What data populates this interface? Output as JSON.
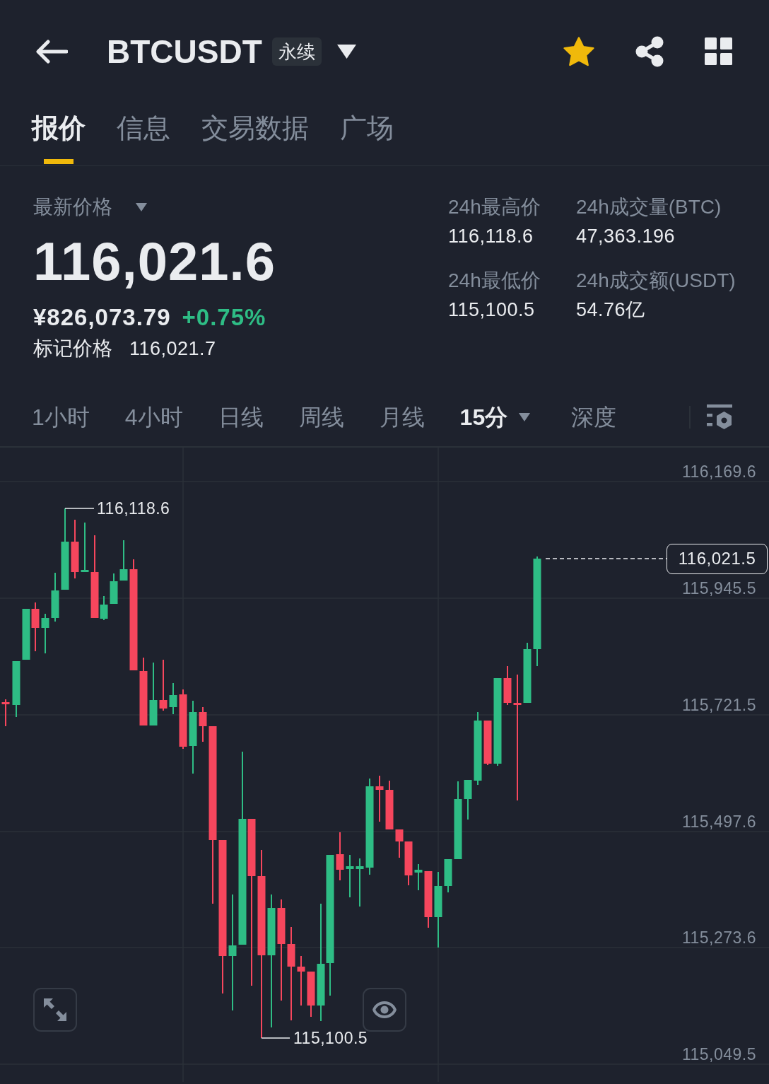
{
  "header": {
    "title": "BTCUSDT",
    "badge": "永续",
    "favorite": true
  },
  "tabs": [
    {
      "label": "报价",
      "selected": true
    },
    {
      "label": "信息",
      "selected": false
    },
    {
      "label": "交易数据",
      "selected": false
    },
    {
      "label": "广场",
      "selected": false
    }
  ],
  "price": {
    "label": "最新价格",
    "last": "116,021.6",
    "cny": "¥826,073.79",
    "change": {
      "text": "+0.75%",
      "color": "#2ebd85"
    },
    "mark_label": "标记价格",
    "mark": "116,021.7"
  },
  "stats": [
    {
      "label": "24h最高价",
      "value": "116,118.6"
    },
    {
      "label": "24h成交量(BTC)",
      "value": "47,363.196"
    },
    {
      "label": "24h最低价",
      "value": "115,100.5"
    },
    {
      "label": "24h成交额(USDT)",
      "value": "54.76亿"
    }
  ],
  "intervals": [
    {
      "label": "1小时",
      "selected": false,
      "has_menu": false
    },
    {
      "label": "4小时",
      "selected": false,
      "has_menu": false
    },
    {
      "label": "日线",
      "selected": false,
      "has_menu": false
    },
    {
      "label": "周线",
      "selected": false,
      "has_menu": false
    },
    {
      "label": "月线",
      "selected": false,
      "has_menu": false
    },
    {
      "label": "15分",
      "selected": true,
      "has_menu": true
    },
    {
      "label": "深度",
      "selected": false,
      "has_menu": false
    }
  ],
  "chart": {
    "price_axis": [
      "116,169.6",
      "115,945.5",
      "115,721.5",
      "115,497.6",
      "115,273.6",
      "115,049.5"
    ],
    "high_label": "116,118.6",
    "low_label": "115,100.5",
    "current_price": "116,021.5"
  }
}
